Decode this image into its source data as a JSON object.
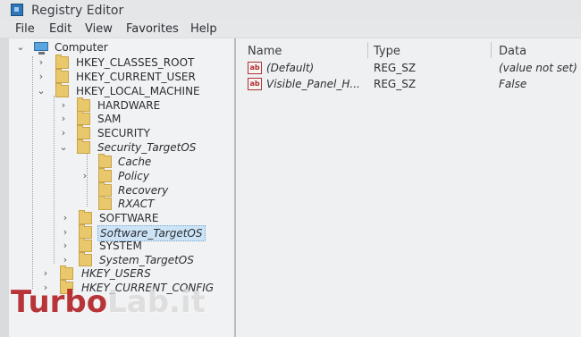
{
  "window": {
    "title": "Registry Editor"
  },
  "menu": [
    "File",
    "Edit",
    "View",
    "Favorites",
    "Help"
  ],
  "tree": {
    "root": "Computer",
    "hives": [
      "HKEY_CLASSES_ROOT",
      "HKEY_CURRENT_USER",
      "HKEY_LOCAL_MACHINE"
    ],
    "hklm_children": [
      "HARDWARE",
      "SAM",
      "SECURITY",
      "Security_TargetOS"
    ],
    "security_targetos_children": [
      "Cache",
      "Policy",
      "Recovery",
      "RXACT"
    ],
    "hklm_more": [
      "SOFTWARE",
      "Software_TargetOS",
      "SYSTEM",
      "System_TargetOS"
    ],
    "more_hives": [
      "HKEY_USERS",
      "HKEY_CURRENT_CONFIG"
    ],
    "selected": "Software_TargetOS"
  },
  "list": {
    "columns": [
      "Name",
      "Type",
      "Data"
    ],
    "rows": [
      {
        "name": "(Default)",
        "type": "REG_SZ",
        "data": "(value not set)",
        "icon_text": "ab"
      },
      {
        "name": "Visible_Panel_H...",
        "type": "REG_SZ",
        "data": "False",
        "icon_text": "ab"
      }
    ]
  },
  "watermark": {
    "part1": "Turbo",
    "part2": "Lab.it"
  }
}
